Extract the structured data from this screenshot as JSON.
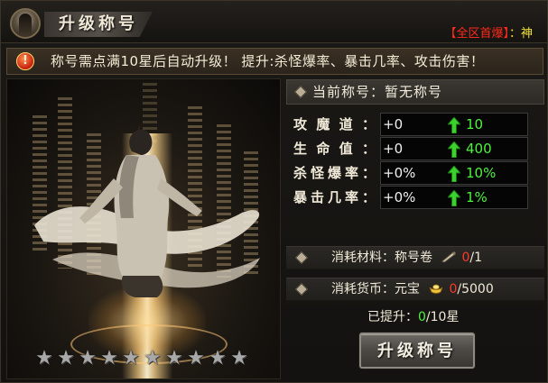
{
  "window": {
    "title": "升级称号"
  },
  "ticker": {
    "tag": "【全区首爆】",
    "sep": "：",
    "name": "神"
  },
  "notice": {
    "icon": "!",
    "text": "称号需点满10星后自动升级！ 提升:杀怪爆率、暴击几率、攻击伤害！"
  },
  "current_title": {
    "label": "当前称号：",
    "value": "暂无称号"
  },
  "stats": [
    {
      "name": "攻魔道：",
      "current": "+0",
      "next": "10"
    },
    {
      "name": "生命值：",
      "current": "+0",
      "next": "400"
    },
    {
      "name": "杀怪爆率：",
      "current": "+0%",
      "next": "10%"
    },
    {
      "name": "暴击几率：",
      "current": "+0%",
      "next": "1%"
    }
  ],
  "cost_material": {
    "label": "消耗材料：",
    "item": "称号卷",
    "have": "0",
    "need_sep": "/",
    "need": "1"
  },
  "cost_currency": {
    "label": "消耗货币：",
    "item": "元宝",
    "have": "0",
    "need_sep": "/",
    "need": "5000"
  },
  "progress": {
    "label": "已提升：",
    "value": "0",
    "suffix": "/10星"
  },
  "stars": {
    "filled": 0,
    "total": 10
  },
  "upgrade_button": {
    "label": "升级称号"
  },
  "icons": {
    "notice": "exclamation-icon",
    "avatar": "character-portrait-icon",
    "arrow": "green-up-arrow-icon",
    "material": "scroll-icon",
    "currency": "gold-ingot-icon",
    "star": "star-icon",
    "bullet": "diamond-bullet-icon"
  },
  "colors": {
    "up_value": "#4ef23e",
    "lack": "#ff3a2a",
    "ticker_tag": "#ff2a1a",
    "ticker_name": "#f3e03a"
  }
}
